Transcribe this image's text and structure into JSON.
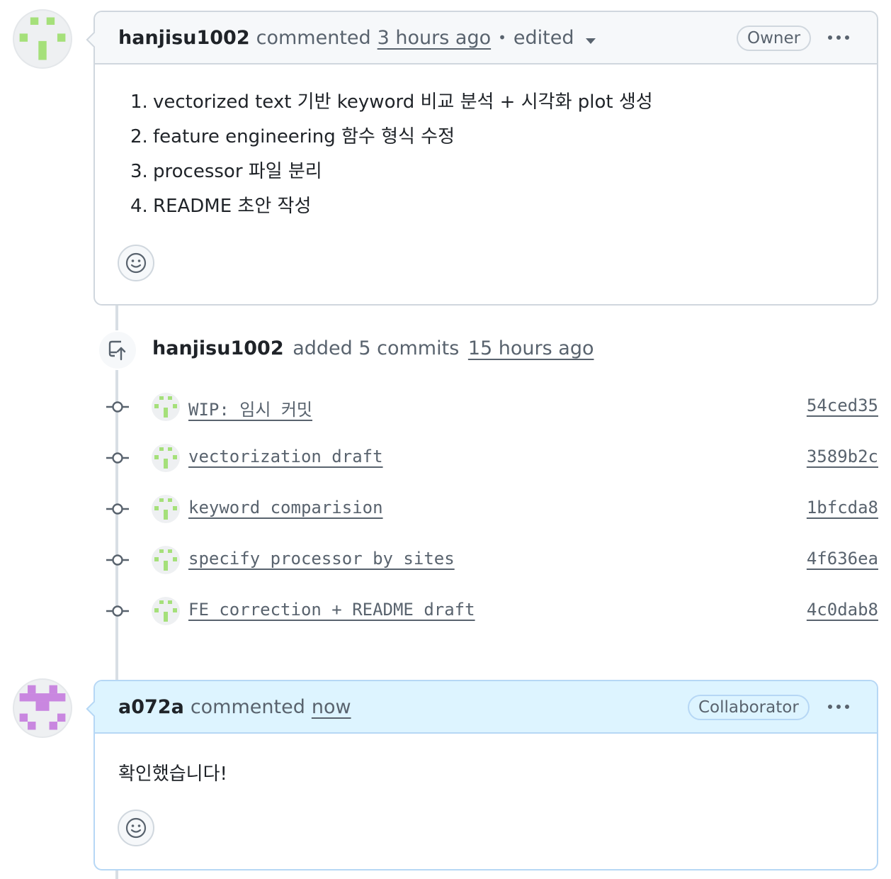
{
  "comment1": {
    "author": "hanjisu1002",
    "action": "commented",
    "time": "3 hours ago",
    "separator": "•",
    "edited": "edited",
    "role": "Owner",
    "items": [
      {
        "num": "1.",
        "text": "vectorized text 기반 keyword 비교 분석 + 시각화 plot 생성"
      },
      {
        "num": "2.",
        "text": "feature engineering 함수 형식 수정"
      },
      {
        "num": "3.",
        "text": "processor 파일 분리"
      },
      {
        "num": "4.",
        "text": "README 초안 작성"
      }
    ]
  },
  "commits_event": {
    "author": "hanjisu1002",
    "action": "added 5 commits",
    "time": "15 hours ago",
    "commits": [
      {
        "message": "WIP: 임시 커밋",
        "sha": "54ced35"
      },
      {
        "message": "vectorization draft",
        "sha": "3589b2c"
      },
      {
        "message": "keyword comparision",
        "sha": "1bfcda8"
      },
      {
        "message": "specify processor by sites",
        "sha": "4f636ea"
      },
      {
        "message": "FE correction + README draft",
        "sha": "4c0dab8"
      }
    ]
  },
  "comment2": {
    "author": "a072a",
    "action": "commented",
    "time": "now",
    "role": "Collaborator",
    "body": "확인했습니다!"
  },
  "colors": {
    "avatar1": "#a5e07a",
    "avatar2": "#c987e0",
    "link": "#59636e",
    "highlight_header": "#ddf4ff"
  },
  "icons": {
    "kebab": "kebab-horizontal-icon",
    "emoji": "smiley-icon",
    "commits": "repo-push-icon",
    "commit": "git-commit-icon",
    "caret": "triangle-down-icon"
  }
}
